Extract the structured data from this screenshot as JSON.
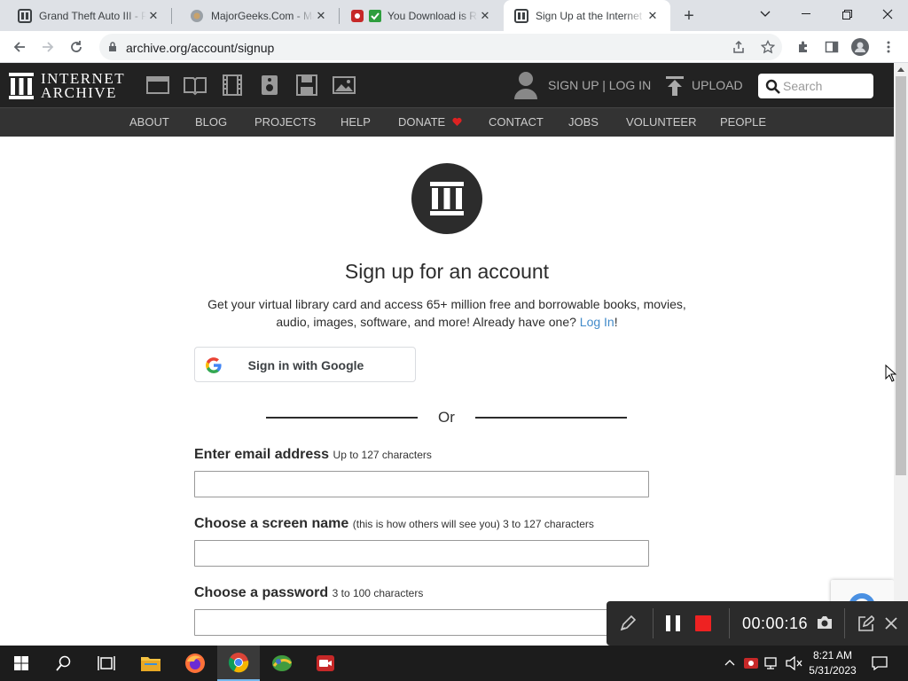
{
  "browser": {
    "tabs": [
      {
        "title": "Grand Theft Auto III - P",
        "active": false
      },
      {
        "title": "MajorGeeks.Com - Maj",
        "active": false
      },
      {
        "title": "You Download is Re",
        "active": false
      },
      {
        "title": "Sign Up at the Internet",
        "active": true
      }
    ],
    "url": "archive.org/account/signup"
  },
  "site": {
    "logo_line1": "INTERNET",
    "logo_line2": "ARCHIVE",
    "signup_login": "SIGN UP | LOG IN",
    "upload": "UPLOAD",
    "search_placeholder": "Search",
    "nav": [
      "ABOUT",
      "BLOG",
      "PROJECTS",
      "HELP",
      "DONATE",
      "CONTACT",
      "JOBS",
      "VOLUNTEER",
      "PEOPLE"
    ]
  },
  "form": {
    "title": "Sign up for an account",
    "desc_line1": "Get your virtual library card and access 65+ million free and borrowable books, movies,",
    "desc_line2": "audio, images, software, and more! Already have one?",
    "login_link": "Log In",
    "login_suffix": "!",
    "google_button": "Sign in with Google",
    "or": "Or",
    "email_label": "Enter email address",
    "email_hint": "Up to 127 characters",
    "screen_label": "Choose a screen name",
    "screen_hint": "(this is how others will see you) 3 to 127 characters",
    "password_label": "Choose a password",
    "password_hint": "3 to 100 characters"
  },
  "recorder": {
    "time": "00:00:16"
  },
  "taskbar": {
    "time": "8:21 AM",
    "date": "5/31/2023"
  },
  "colors": {
    "accent_link": "#428bca",
    "heart": "#dd2222",
    "record": "#ee2222"
  }
}
